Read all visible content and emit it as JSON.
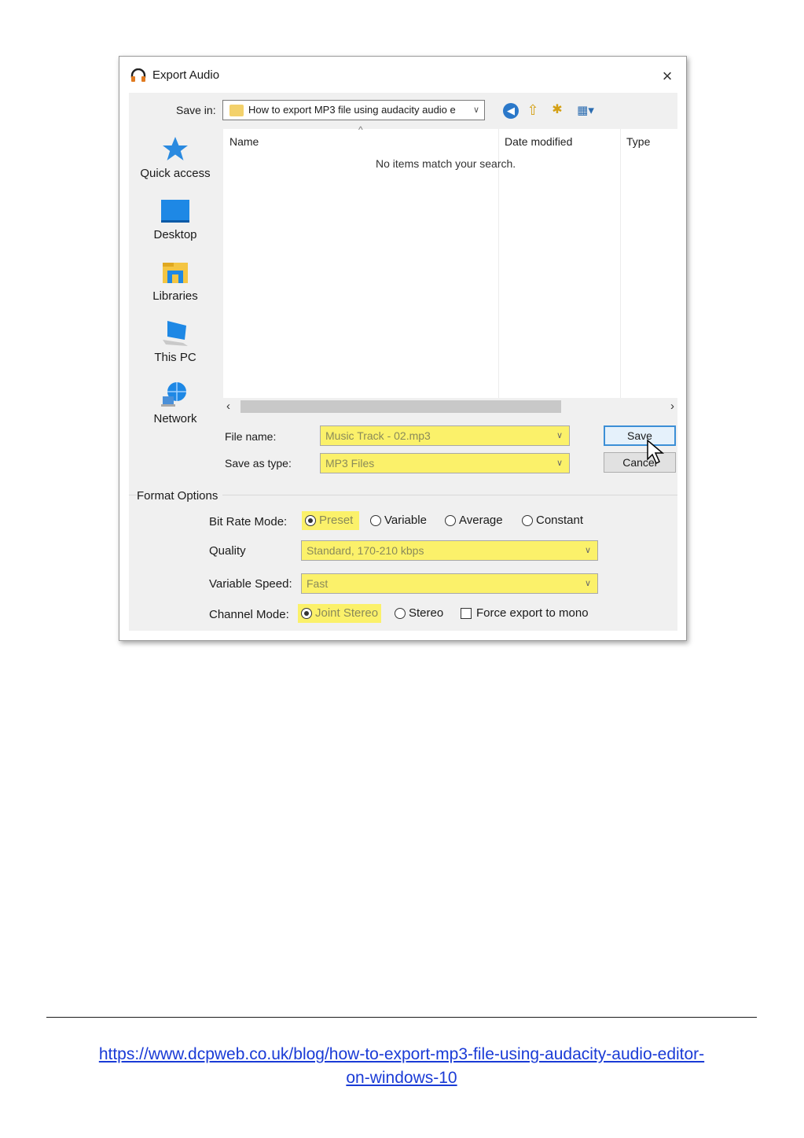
{
  "dialog": {
    "title": "Export Audio",
    "close_glyph": "×",
    "title_icon": "headphones-icon"
  },
  "save_in": {
    "label": "Save in:",
    "value": "How to export MP3 file using audacity audio e",
    "toolbar_icons": [
      "back-icon",
      "up-folder-icon",
      "new-folder-icon",
      "view-menu-icon"
    ]
  },
  "places": [
    {
      "label": "Quick access",
      "icon": "star-icon"
    },
    {
      "label": "Desktop",
      "icon": "desktop-icon"
    },
    {
      "label": "Libraries",
      "icon": "libraries-icon"
    },
    {
      "label": "This PC",
      "icon": "computer-icon"
    },
    {
      "label": "Network",
      "icon": "network-icon"
    }
  ],
  "file_list": {
    "columns": [
      "Name",
      "Date modified",
      "Type"
    ],
    "empty_message": "No items match your search."
  },
  "file_name": {
    "label": "File name:",
    "value": "Music Track - 02.mp3"
  },
  "save_as_type": {
    "label": "Save as type:",
    "value": "MP3 Files"
  },
  "buttons": {
    "save": "Save",
    "cancel": "Cancel"
  },
  "format_options": {
    "title": "Format Options",
    "bit_rate_mode": {
      "label": "Bit Rate Mode:",
      "options": [
        "Preset",
        "Variable",
        "Average",
        "Constant"
      ],
      "selected": "Preset"
    },
    "quality": {
      "label": "Quality",
      "value": "Standard, 170-210 kbps"
    },
    "variable_speed": {
      "label": "Variable Speed:",
      "value": "Fast"
    },
    "channel_mode": {
      "label": "Channel Mode:",
      "options": [
        "Joint Stereo",
        "Stereo"
      ],
      "selected": "Joint Stereo",
      "force_mono_label": "Force export to mono",
      "force_mono_checked": false
    }
  },
  "colors": {
    "highlight": "#fbf16a",
    "link": "#1a3bd6",
    "accent": "#3c8fd6"
  },
  "footer": {
    "url_line1": "https://www.dcpweb.co.uk/blog/how-to-export-mp3-file-using-audacity-audio-editor-",
    "url_line2": "on-windows-10"
  }
}
